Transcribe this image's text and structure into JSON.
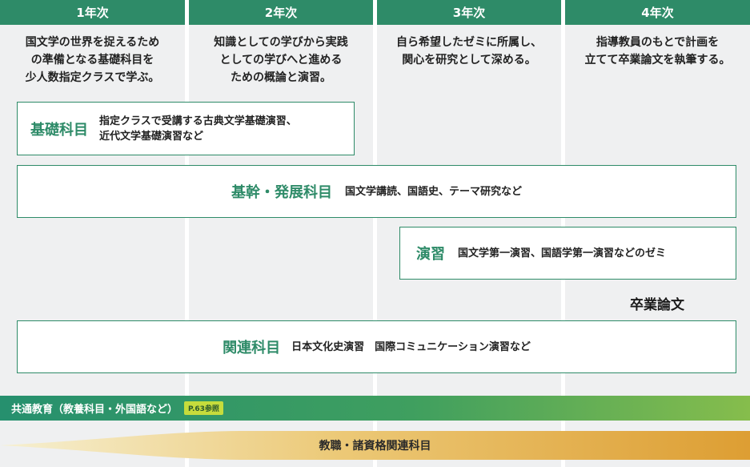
{
  "years": [
    {
      "label": "1年次",
      "desc": [
        "国文学の世界を捉えるため",
        "の準備となる基礎科目を",
        "少人数指定クラスで学ぶ。"
      ]
    },
    {
      "label": "2年次",
      "desc": [
        "知識としての学びから実践",
        "としての学びへと進める",
        "ための概論と演習。"
      ]
    },
    {
      "label": "3年次",
      "desc": [
        "自ら希望したゼミに所属し、",
        "関心を研究として深める。"
      ]
    },
    {
      "label": "4年次",
      "desc": [
        "指導教員のもとで計画を",
        "立てて卒業論文を執筆する。"
      ]
    }
  ],
  "courses": {
    "basic": {
      "title": "基礎科目",
      "desc_line1": "指定クラスで受講する古典文学基礎演習、",
      "desc_line2": "近代文学基礎演習など"
    },
    "core": {
      "title": "基幹・発展科目",
      "desc": "国文学講読、国語史、テーマ研究など"
    },
    "seminar": {
      "title": "演習",
      "desc": "国文学第一演習、国語学第一演習などのゼミ"
    },
    "thesis": {
      "title": "卒業論文"
    },
    "related": {
      "title": "関連科目",
      "desc": "日本文化史演習　国際コミュニケーション演習など"
    }
  },
  "general": {
    "label": "共通教育（教養科目・外国語など）",
    "badge": "P.63参照"
  },
  "teacher": {
    "label": "教職・諸資格関連科目"
  },
  "colors": {
    "accent": "#2e8b68",
    "column_bg": "#eff0f1",
    "badge": "#c6dc3c",
    "arrow_start": "#f4ecc8",
    "arrow_end": "#dd9e33"
  }
}
